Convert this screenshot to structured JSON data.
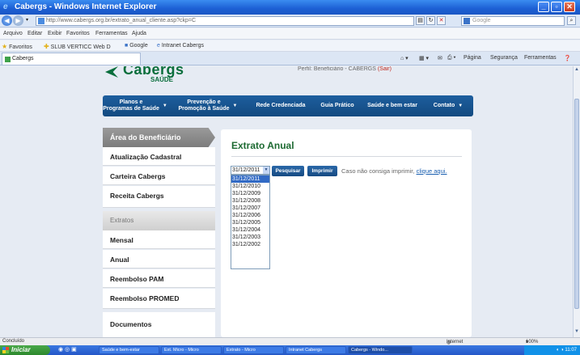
{
  "window": {
    "title": "Cabergs - Windows Internet Explorer",
    "url": "http://www.cabergs.org.br/extrato_anual_cliente.asp?ckp=C",
    "search_placeholder": "Google"
  },
  "menu": [
    "Arquivo",
    "Editar",
    "Exibir",
    "Favoritos",
    "Ferramentas",
    "Ajuda"
  ],
  "favorites": {
    "label": "Favoritos",
    "items": [
      "SLUB VERTICC Web D",
      "Google",
      "Intranet Cabergs"
    ]
  },
  "tab": {
    "label": "Cabergs"
  },
  "command_bar": [
    "Página",
    "Segurança",
    "Ferramentas"
  ],
  "site": {
    "logo_name": "Cabergs",
    "logo_sub": "SAÚDE",
    "profile_text": "Perfil: Beneficiário - CABERGS",
    "logout": "(Sair)"
  },
  "nav": [
    {
      "label": "Planos e\nProgramas de Saúde",
      "caret": "▼"
    },
    {
      "label": "Prevenção e\nPromoção à Saúde",
      "caret": "▼"
    },
    {
      "label": "Rede Credenciada",
      "caret": ""
    },
    {
      "label": "Guia Prático",
      "caret": ""
    },
    {
      "label": "Saúde e bem estar",
      "caret": ""
    },
    {
      "label": "Contato",
      "caret": "▼"
    }
  ],
  "sidebar": {
    "header": "Área do Beneficiário",
    "items": [
      "Atualização Cadastral",
      "Carteira Cabergs",
      "Receita Cabergs"
    ],
    "section": "Extratos",
    "extratos": [
      "Mensal",
      "Anual",
      "Reembolso PAM",
      "Reembolso PROMED"
    ],
    "documentos": "Documentos"
  },
  "content": {
    "title": "Extrato Anual",
    "selected_date": "31/12/2011",
    "date_options": [
      "31/12/2011",
      "31/12/2010",
      "31/12/2009",
      "31/12/2008",
      "31/12/2007",
      "31/12/2006",
      "31/12/2005",
      "31/12/2004",
      "31/12/2003",
      "31/12/2002"
    ],
    "search_button": "Pesquisar",
    "print_button": "Imprimir",
    "hint_text": "Caso não consiga imprimir,",
    "hint_link": "clique aqui."
  },
  "status": {
    "left": "Concluído",
    "zone": "Internet",
    "zoom": "100%"
  },
  "taskbar": {
    "start": "Iniciar",
    "tasks": [
      "Saúde e bem-estar",
      "Ext. Micro - Micro",
      "Extrato - Micro",
      "Intranet Cabergs",
      "Cabergs - Windo..."
    ],
    "clock": "11:07"
  }
}
